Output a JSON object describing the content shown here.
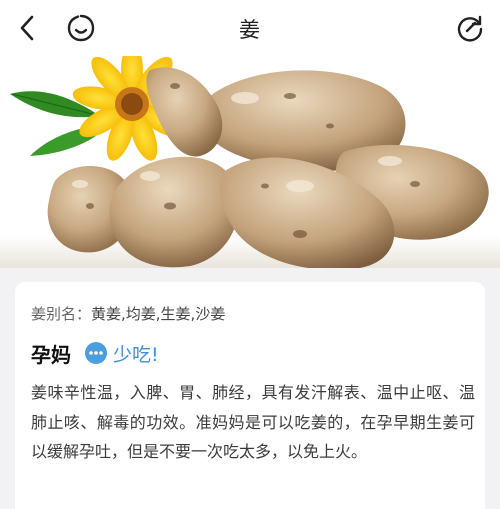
{
  "header": {
    "title": "姜",
    "back_icon": "chevron-left-icon",
    "face_icon": "smiley-face-icon",
    "refresh_icon": "refresh-icon"
  },
  "hero": {
    "image": "ginger-tubers-with-sunflower-photo"
  },
  "card": {
    "alias_label": "姜别名：",
    "alias_value": "黄姜,均姜,生姜,沙姜",
    "status_title": "孕妈",
    "status_icon": "more-dots-icon",
    "status_text": "少吃!",
    "status_color": "#3b8fdc",
    "description": "姜味辛性温，入脾、胃、肺经，具有发汗解表、温中止呕、温肺止咳、解毒的功效。准妈妈是可以吃姜的，在孕早期生姜可以缓解孕吐，但是不要一次吃太多，以免上火。"
  }
}
